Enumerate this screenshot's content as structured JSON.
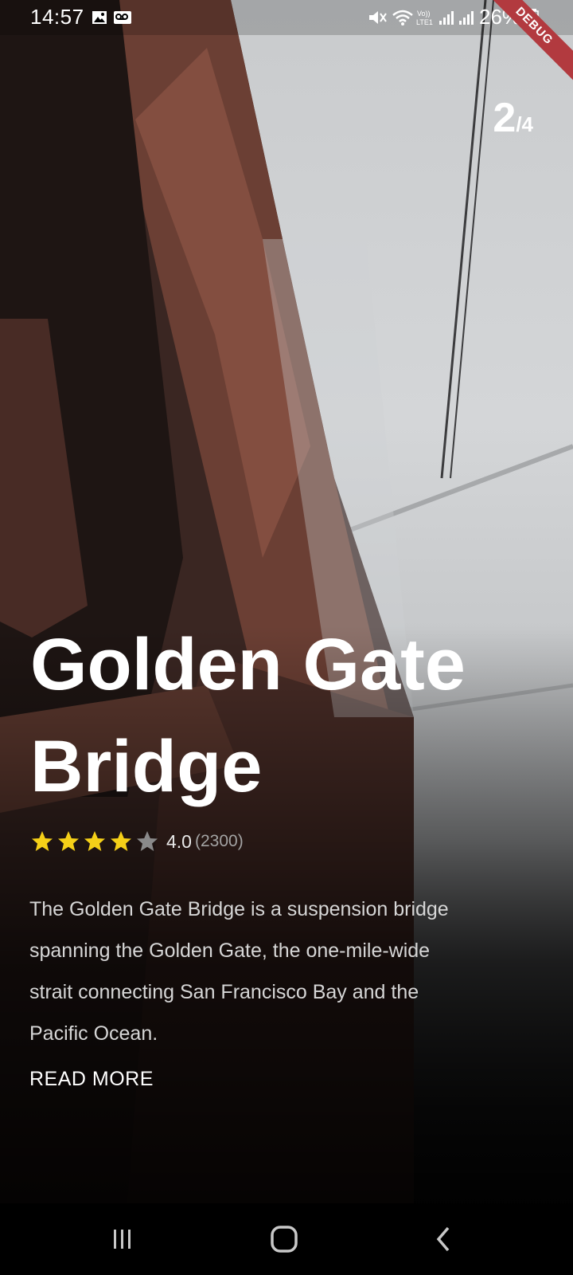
{
  "status_bar": {
    "time": "14:57",
    "battery": "26%",
    "icons": [
      "image-icon",
      "voicemail-icon",
      "mute-icon",
      "wifi-icon",
      "volte-icon",
      "signal-icon",
      "signal-icon-2",
      "battery-icon"
    ]
  },
  "debug_banner": "DEBUG",
  "pager": {
    "current": "2",
    "total": "/4"
  },
  "place": {
    "title": "Golden Gate Bridge",
    "rating": "4.0",
    "rating_count": "(2300)",
    "stars": 4,
    "star_max": 5,
    "description": "The Golden Gate Bridge is a suspension bridge spanning the Golden Gate, the one-mile-wide strait connecting San Francisco Bay and the Pacific Ocean.",
    "read_more": "READ MORE"
  },
  "colors": {
    "star_filled": "#f5d018",
    "star_empty": "#8a8a8a",
    "debug_ribbon": "#b23a3f"
  },
  "nav_bar": {
    "icons": [
      "recents-icon",
      "home-icon",
      "back-icon"
    ]
  }
}
